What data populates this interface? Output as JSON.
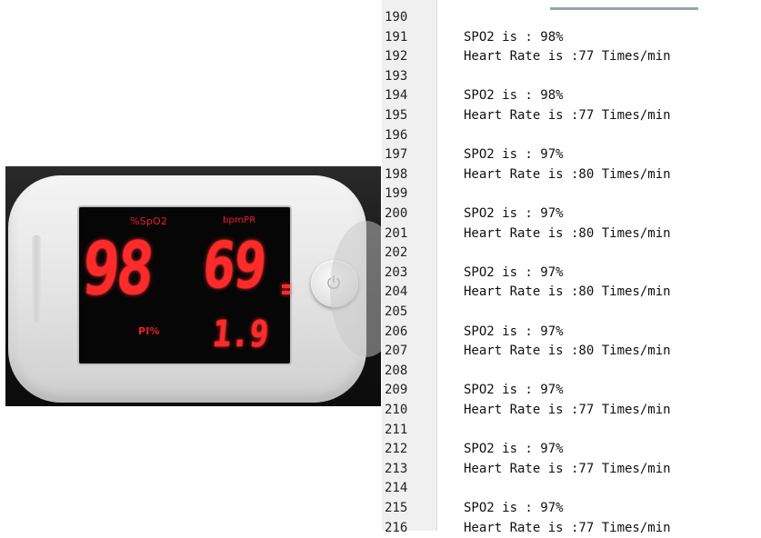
{
  "oximeter": {
    "spo2_label": "%SpO2",
    "pr_label": "bpmPR",
    "pi_label": "PI%",
    "spo2_value": "98",
    "pr_value": "69",
    "pi_value": "1.9",
    "display_color": "#ff2a2a"
  },
  "console": {
    "lines": [
      {
        "num": "190",
        "text": ""
      },
      {
        "num": "191",
        "text": "SPO2 is : 98%"
      },
      {
        "num": "192",
        "text": "Heart Rate is :77 Times/min"
      },
      {
        "num": "193",
        "text": ""
      },
      {
        "num": "194",
        "text": "SPO2 is : 98%"
      },
      {
        "num": "195",
        "text": "Heart Rate is :77 Times/min"
      },
      {
        "num": "196",
        "text": ""
      },
      {
        "num": "197",
        "text": "SPO2 is : 97%"
      },
      {
        "num": "198",
        "text": "Heart Rate is :80 Times/min"
      },
      {
        "num": "199",
        "text": ""
      },
      {
        "num": "200",
        "text": "SPO2 is : 97%"
      },
      {
        "num": "201",
        "text": "Heart Rate is :80 Times/min"
      },
      {
        "num": "202",
        "text": ""
      },
      {
        "num": "203",
        "text": "SPO2 is : 97%"
      },
      {
        "num": "204",
        "text": "Heart Rate is :80 Times/min"
      },
      {
        "num": "205",
        "text": ""
      },
      {
        "num": "206",
        "text": "SPO2 is : 97%"
      },
      {
        "num": "207",
        "text": "Heart Rate is :80 Times/min"
      },
      {
        "num": "208",
        "text": ""
      },
      {
        "num": "209",
        "text": "SPO2 is : 97%"
      },
      {
        "num": "210",
        "text": "Heart Rate is :77 Times/min"
      },
      {
        "num": "211",
        "text": ""
      },
      {
        "num": "212",
        "text": "SPO2 is : 97%"
      },
      {
        "num": "213",
        "text": "Heart Rate is :77 Times/min"
      },
      {
        "num": "214",
        "text": ""
      },
      {
        "num": "215",
        "text": "SPO2 is : 97%"
      },
      {
        "num": "216",
        "text": "Heart Rate is :77 Times/min"
      }
    ]
  }
}
